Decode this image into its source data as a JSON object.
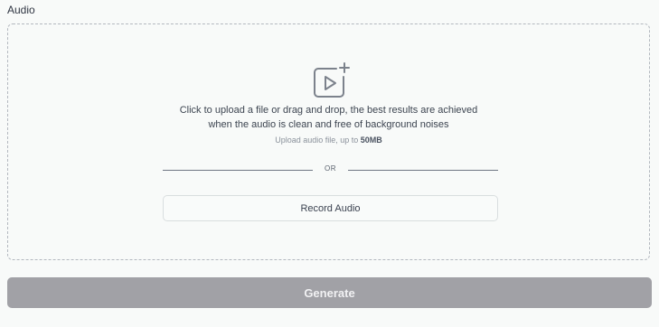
{
  "field": {
    "label": "Audio"
  },
  "dropzone": {
    "icon": "video-plus-icon",
    "instruction_line1": "Click to upload a file or drag and drop, the best results are achieved",
    "instruction_line2": "when the audio is clean and free of background noises",
    "hint_prefix": "Upload audio file, up to ",
    "hint_size": "50MB",
    "divider_text": "OR",
    "record_label": "Record Audio"
  },
  "actions": {
    "generate_label": "Generate",
    "generate_enabled": false
  },
  "colors": {
    "background": "#f8faf9",
    "dashed_border": "#b3b8bf",
    "icon_stroke": "#7c828c",
    "generate_disabled": "#a1a1a6"
  }
}
